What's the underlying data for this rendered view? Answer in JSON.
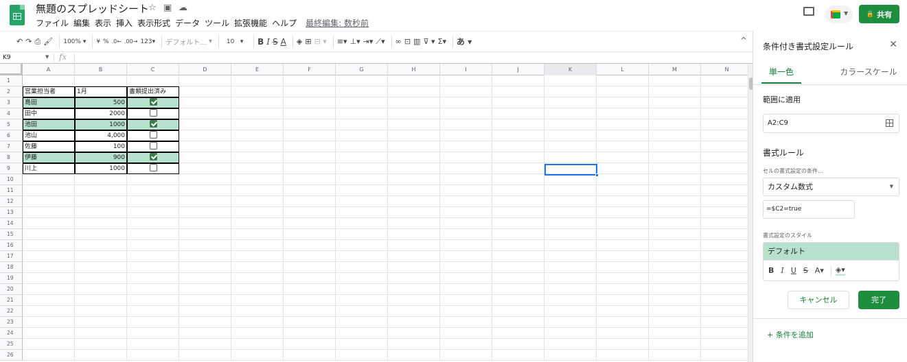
{
  "app": {
    "doc_title": "無題のスプレッドシート",
    "menus": [
      "ファイル",
      "編集",
      "表示",
      "挿入",
      "表示形式",
      "データ",
      "ツール",
      "拡張機能",
      "ヘルプ"
    ],
    "last_edit": "最終編集: 数秒前",
    "share_label": "共有",
    "share_icon": "lock-icon",
    "accent_color": "#1e8e3e"
  },
  "toolbar": {
    "zoom": "100%",
    "currency": "¥",
    "percent": "%",
    "decimal_dec": ".0←",
    "decimal_inc": ".00→",
    "format_more": "123▾",
    "font": "デフォルト...",
    "font_size": "10",
    "bold": "B",
    "italic": "I",
    "strike": "S",
    "text_color": "A",
    "input_tools": "あ"
  },
  "formula_bar": {
    "name_box": "K9",
    "fx": "fx"
  },
  "sheet": {
    "columns": [
      "A",
      "B",
      "C",
      "D",
      "E",
      "F",
      "G",
      "H",
      "I",
      "J",
      "K",
      "L",
      "M",
      "N"
    ],
    "selected_column": "K",
    "selected_cell": "K9",
    "header_row": [
      "営業担当者",
      "1月",
      "書類提出済み"
    ],
    "rows": [
      {
        "name": "島田",
        "amount": "500",
        "submitted": true
      },
      {
        "name": "田中",
        "amount": "2000",
        "submitted": false
      },
      {
        "name": "池田",
        "amount": "1000",
        "submitted": true
      },
      {
        "name": "池山",
        "amount": "4,000",
        "submitted": false
      },
      {
        "name": "佐藤",
        "amount": "100",
        "submitted": false
      },
      {
        "name": "伊藤",
        "amount": "900",
        "submitted": true
      },
      {
        "name": "川上",
        "amount": "1000",
        "submitted": false
      }
    ],
    "highlight_color": "#b7e1cd",
    "row_count": 26
  },
  "panel": {
    "title": "条件付き書式設定ルール",
    "tab_single": "単一色",
    "tab_scale": "カラースケール",
    "range_label": "範囲に適用",
    "range_value": "A2:C9",
    "rules_label": "書式ルール",
    "condition_label": "セルの書式設定の条件...",
    "condition_value": "カスタム数式",
    "formula_value": "=$C2=true",
    "style_label": "書式設定のスタイル",
    "style_preview": "デフォルト",
    "cancel_label": "キャンセル",
    "done_label": "完了",
    "add_condition": "+ 条件を追加"
  }
}
